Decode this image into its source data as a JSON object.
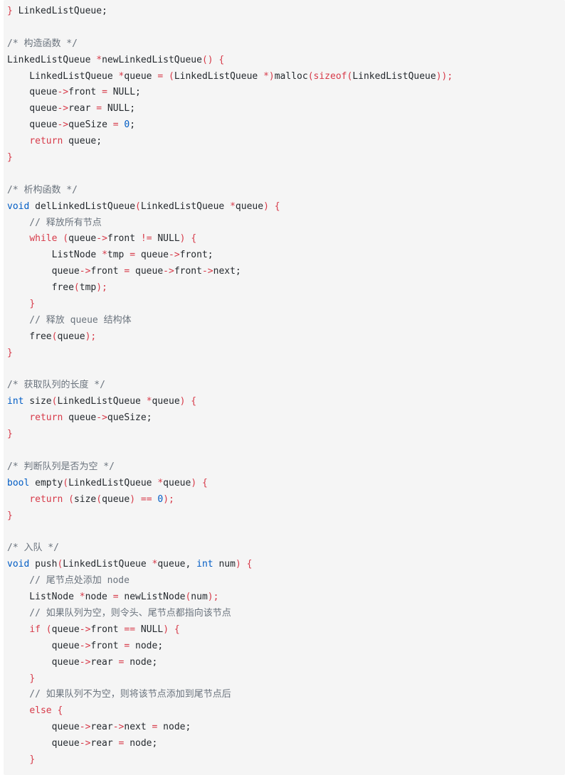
{
  "colors": {
    "background": "#f5f5f5",
    "plain": "#24292e",
    "comment": "#6a737d",
    "keyword": "#d73a49",
    "type": "#005cc5"
  },
  "code": [
    [
      [
        "p",
        "}"
      ],
      [
        "t",
        " LinkedListQueue;"
      ]
    ],
    [],
    [
      [
        "c",
        "/* 构造函数 */"
      ]
    ],
    [
      [
        "t",
        "LinkedListQueue "
      ],
      [
        "p",
        "*"
      ],
      [
        "t",
        "newLinkedListQueue"
      ],
      [
        "p",
        "() {"
      ]
    ],
    [
      [
        "t",
        "    LinkedListQueue "
      ],
      [
        "p",
        "*"
      ],
      [
        "t",
        "queue "
      ],
      [
        "p",
        "="
      ],
      [
        "t",
        " "
      ],
      [
        "p",
        "("
      ],
      [
        "t",
        "LinkedListQueue "
      ],
      [
        "p",
        "*)"
      ],
      [
        "t",
        "malloc"
      ],
      [
        "p",
        "("
      ],
      [
        "k",
        "sizeof"
      ],
      [
        "p",
        "("
      ],
      [
        "t",
        "LinkedListQueue"
      ],
      [
        "p",
        "));"
      ]
    ],
    [
      [
        "t",
        "    queue"
      ],
      [
        "p",
        "->"
      ],
      [
        "t",
        "front "
      ],
      [
        "p",
        "="
      ],
      [
        "t",
        " NULL;"
      ]
    ],
    [
      [
        "t",
        "    queue"
      ],
      [
        "p",
        "->"
      ],
      [
        "t",
        "rear "
      ],
      [
        "p",
        "="
      ],
      [
        "t",
        " NULL;"
      ]
    ],
    [
      [
        "t",
        "    queue"
      ],
      [
        "p",
        "->"
      ],
      [
        "t",
        "queSize "
      ],
      [
        "p",
        "="
      ],
      [
        "t",
        " "
      ],
      [
        "n",
        "0"
      ],
      [
        "t",
        ";"
      ]
    ],
    [
      [
        "t",
        "    "
      ],
      [
        "k",
        "return"
      ],
      [
        "t",
        " queue;"
      ]
    ],
    [
      [
        "p",
        "}"
      ]
    ],
    [],
    [
      [
        "c",
        "/* 析构函数 */"
      ]
    ],
    [
      [
        "y",
        "void"
      ],
      [
        "t",
        " delLinkedListQueue"
      ],
      [
        "p",
        "("
      ],
      [
        "t",
        "LinkedListQueue "
      ],
      [
        "p",
        "*"
      ],
      [
        "t",
        "queue"
      ],
      [
        "p",
        ") {"
      ]
    ],
    [
      [
        "c",
        "    // 释放所有节点"
      ]
    ],
    [
      [
        "t",
        "    "
      ],
      [
        "k",
        "while"
      ],
      [
        "t",
        " "
      ],
      [
        "p",
        "("
      ],
      [
        "t",
        "queue"
      ],
      [
        "p",
        "->"
      ],
      [
        "t",
        "front "
      ],
      [
        "p",
        "!="
      ],
      [
        "t",
        " NULL"
      ],
      [
        "p",
        ") {"
      ]
    ],
    [
      [
        "t",
        "        ListNode "
      ],
      [
        "p",
        "*"
      ],
      [
        "t",
        "tmp "
      ],
      [
        "p",
        "="
      ],
      [
        "t",
        " queue"
      ],
      [
        "p",
        "->"
      ],
      [
        "t",
        "front;"
      ]
    ],
    [
      [
        "t",
        "        queue"
      ],
      [
        "p",
        "->"
      ],
      [
        "t",
        "front "
      ],
      [
        "p",
        "="
      ],
      [
        "t",
        " queue"
      ],
      [
        "p",
        "->"
      ],
      [
        "t",
        "front"
      ],
      [
        "p",
        "->"
      ],
      [
        "t",
        "next;"
      ]
    ],
    [
      [
        "t",
        "        free"
      ],
      [
        "p",
        "("
      ],
      [
        "t",
        "tmp"
      ],
      [
        "p",
        ");"
      ]
    ],
    [
      [
        "t",
        "    "
      ],
      [
        "p",
        "}"
      ]
    ],
    [
      [
        "c",
        "    // 释放 queue 结构体"
      ]
    ],
    [
      [
        "t",
        "    free"
      ],
      [
        "p",
        "("
      ],
      [
        "t",
        "queue"
      ],
      [
        "p",
        ");"
      ]
    ],
    [
      [
        "p",
        "}"
      ]
    ],
    [],
    [
      [
        "c",
        "/* 获取队列的长度 */"
      ]
    ],
    [
      [
        "y",
        "int"
      ],
      [
        "t",
        " size"
      ],
      [
        "p",
        "("
      ],
      [
        "t",
        "LinkedListQueue "
      ],
      [
        "p",
        "*"
      ],
      [
        "t",
        "queue"
      ],
      [
        "p",
        ") {"
      ]
    ],
    [
      [
        "t",
        "    "
      ],
      [
        "k",
        "return"
      ],
      [
        "t",
        " queue"
      ],
      [
        "p",
        "->"
      ],
      [
        "t",
        "queSize;"
      ]
    ],
    [
      [
        "p",
        "}"
      ]
    ],
    [],
    [
      [
        "c",
        "/* 判断队列是否为空 */"
      ]
    ],
    [
      [
        "y",
        "bool"
      ],
      [
        "t",
        " empty"
      ],
      [
        "p",
        "("
      ],
      [
        "t",
        "LinkedListQueue "
      ],
      [
        "p",
        "*"
      ],
      [
        "t",
        "queue"
      ],
      [
        "p",
        ") {"
      ]
    ],
    [
      [
        "t",
        "    "
      ],
      [
        "k",
        "return"
      ],
      [
        "t",
        " "
      ],
      [
        "p",
        "("
      ],
      [
        "t",
        "size"
      ],
      [
        "p",
        "("
      ],
      [
        "t",
        "queue"
      ],
      [
        "p",
        ")"
      ],
      [
        "t",
        " "
      ],
      [
        "p",
        "=="
      ],
      [
        "t",
        " "
      ],
      [
        "n",
        "0"
      ],
      [
        "p",
        ");"
      ]
    ],
    [
      [
        "p",
        "}"
      ]
    ],
    [],
    [
      [
        "c",
        "/* 入队 */"
      ]
    ],
    [
      [
        "y",
        "void"
      ],
      [
        "t",
        " push"
      ],
      [
        "p",
        "("
      ],
      [
        "t",
        "LinkedListQueue "
      ],
      [
        "p",
        "*"
      ],
      [
        "t",
        "queue, "
      ],
      [
        "y",
        "int"
      ],
      [
        "t",
        " num"
      ],
      [
        "p",
        ") {"
      ]
    ],
    [
      [
        "c",
        "    // 尾节点处添加 node"
      ]
    ],
    [
      [
        "t",
        "    ListNode "
      ],
      [
        "p",
        "*"
      ],
      [
        "t",
        "node "
      ],
      [
        "p",
        "="
      ],
      [
        "t",
        " newListNode"
      ],
      [
        "p",
        "("
      ],
      [
        "t",
        "num"
      ],
      [
        "p",
        ");"
      ]
    ],
    [
      [
        "c",
        "    // 如果队列为空，则令头、尾节点都指向该节点"
      ]
    ],
    [
      [
        "t",
        "    "
      ],
      [
        "k",
        "if"
      ],
      [
        "t",
        " "
      ],
      [
        "p",
        "("
      ],
      [
        "t",
        "queue"
      ],
      [
        "p",
        "->"
      ],
      [
        "t",
        "front "
      ],
      [
        "p",
        "=="
      ],
      [
        "t",
        " NULL"
      ],
      [
        "p",
        ") {"
      ]
    ],
    [
      [
        "t",
        "        queue"
      ],
      [
        "p",
        "->"
      ],
      [
        "t",
        "front "
      ],
      [
        "p",
        "="
      ],
      [
        "t",
        " node;"
      ]
    ],
    [
      [
        "t",
        "        queue"
      ],
      [
        "p",
        "->"
      ],
      [
        "t",
        "rear "
      ],
      [
        "p",
        "="
      ],
      [
        "t",
        " node;"
      ]
    ],
    [
      [
        "t",
        "    "
      ],
      [
        "p",
        "}"
      ]
    ],
    [
      [
        "c",
        "    // 如果队列不为空，则将该节点添加到尾节点后"
      ]
    ],
    [
      [
        "t",
        "    "
      ],
      [
        "k",
        "else"
      ],
      [
        "t",
        " "
      ],
      [
        "p",
        "{"
      ]
    ],
    [
      [
        "t",
        "        queue"
      ],
      [
        "p",
        "->"
      ],
      [
        "t",
        "rear"
      ],
      [
        "p",
        "->"
      ],
      [
        "t",
        "next "
      ],
      [
        "p",
        "="
      ],
      [
        "t",
        " node;"
      ]
    ],
    [
      [
        "t",
        "        queue"
      ],
      [
        "p",
        "->"
      ],
      [
        "t",
        "rear "
      ],
      [
        "p",
        "="
      ],
      [
        "t",
        " node;"
      ]
    ],
    [
      [
        "t",
        "    "
      ],
      [
        "p",
        "}"
      ]
    ]
  ]
}
